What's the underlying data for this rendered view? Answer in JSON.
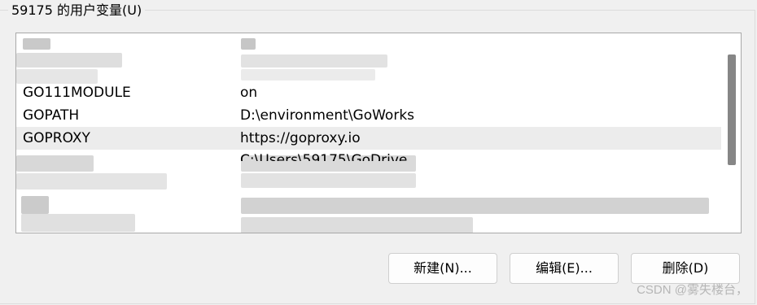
{
  "group": {
    "title": "59175 的用户变量(U)"
  },
  "variables": [
    {
      "name": "GO111MODULE",
      "value": "on"
    },
    {
      "name": "GOPATH",
      "value": "D:\\environment\\GoWorks"
    },
    {
      "name": "GOPROXY",
      "value": "https://goproxy.io"
    },
    {
      "name": "",
      "value": "C:\\Users\\59175\\GoDrive"
    }
  ],
  "buttons": {
    "new_label": "新建(N)...",
    "edit_label": "编辑(E)...",
    "delete_label": "删除(D)"
  },
  "watermark": "CSDN @雾失楼台，",
  "colors": {
    "window_bg": "#f0f0f0",
    "list_bg": "#ffffff",
    "selected_row": "#ececec",
    "scrollbar_thumb": "#868686"
  }
}
